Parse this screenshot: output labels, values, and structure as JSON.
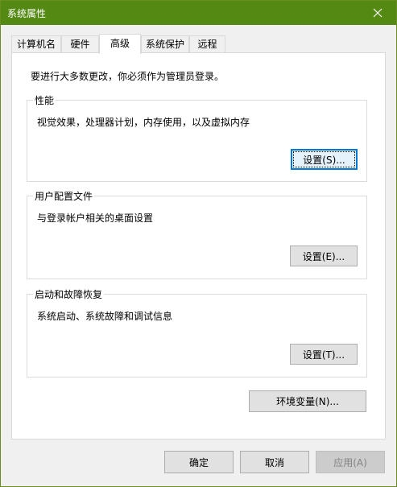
{
  "window": {
    "title": "系统属性"
  },
  "tabs": [
    {
      "label": "计算机名"
    },
    {
      "label": "硬件"
    },
    {
      "label": "高级",
      "active": true
    },
    {
      "label": "系统保护"
    },
    {
      "label": "远程"
    }
  ],
  "advanced": {
    "notice": "要进行大多数更改，你必须作为管理员登录。",
    "performance": {
      "title": "性能",
      "description": "视觉效果，处理器计划，内存使用，以及虚拟内存",
      "button": "设置(S)..."
    },
    "user_profiles": {
      "title": "用户配置文件",
      "description": "与登录帐户相关的桌面设置",
      "button": "设置(E)..."
    },
    "startup_recovery": {
      "title": "启动和故障恢复",
      "description": "系统启动、系统故障和调试信息",
      "button": "设置(T)..."
    },
    "env_button": "环境变量(N)..."
  },
  "footer": {
    "ok": "确定",
    "cancel": "取消",
    "apply": "应用(A)"
  },
  "colors": {
    "titlebar": "#548a14",
    "focus_border": "#0078d7"
  },
  "icons": {
    "close": "close-icon"
  }
}
